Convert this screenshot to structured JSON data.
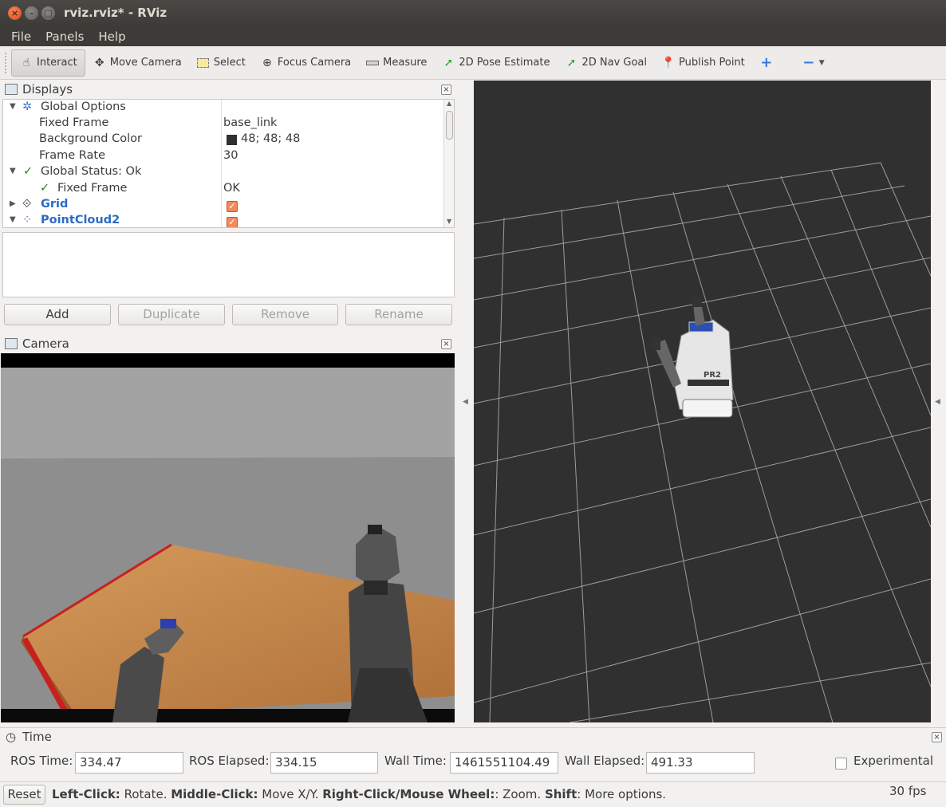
{
  "window": {
    "title": "rviz.rviz* - RViz"
  },
  "menu": [
    "File",
    "Panels",
    "Help"
  ],
  "toolbar": {
    "tools": [
      {
        "label": "Interact",
        "icon": "hand-icon",
        "active": true
      },
      {
        "label": "Move Camera",
        "icon": "move-camera-icon"
      },
      {
        "label": "Select",
        "icon": "select-icon"
      },
      {
        "label": "Focus Camera",
        "icon": "focus-camera-icon"
      },
      {
        "label": "Measure",
        "icon": "measure-icon"
      },
      {
        "label": "2D Pose Estimate",
        "icon": "green-arrow-icon"
      },
      {
        "label": "2D Nav Goal",
        "icon": "green-arrow-icon"
      },
      {
        "label": "Publish Point",
        "icon": "map-pin-icon"
      }
    ]
  },
  "displays": {
    "title": "Displays",
    "global_options": "Global Options",
    "fixed_frame_label": "Fixed Frame",
    "fixed_frame_value": "base_link",
    "background_color_label": "Background Color",
    "background_color_value": "48; 48; 48",
    "frame_rate_label": "Frame Rate",
    "frame_rate_value": "30",
    "global_status": "Global Status: Ok",
    "status_fixed_frame": "Fixed Frame",
    "status_fixed_frame_value": "OK",
    "grid": "Grid",
    "pointcloud": "PointCloud2"
  },
  "buttons": {
    "add": "Add",
    "duplicate": "Duplicate",
    "remove": "Remove",
    "rename": "Rename"
  },
  "camera": {
    "title": "Camera"
  },
  "time": {
    "title": "Time",
    "ros_time_label": "ROS Time:",
    "ros_time": "334.47",
    "ros_elapsed_label": "ROS Elapsed:",
    "ros_elapsed": "334.15",
    "wall_time_label": "Wall Time:",
    "wall_time": "1461551104.49",
    "wall_elapsed_label": "Wall Elapsed:",
    "wall_elapsed": "491.33",
    "experimental": "Experimental"
  },
  "status": {
    "reset": "Reset",
    "left_click": "Left-Click:",
    "left_click_desc": " Rotate. ",
    "middle_click": "Middle-Click:",
    "middle_click_desc": " Move X/Y. ",
    "right_click": "Right-Click/Mouse Wheel:",
    "right_click_desc": ": Zoom. ",
    "shift": "Shift",
    "shift_desc": ": More options.",
    "fps": "30 fps"
  },
  "colors": {
    "background": "#303030",
    "accent": "#f08b5b",
    "link": "#2b6cc4"
  }
}
